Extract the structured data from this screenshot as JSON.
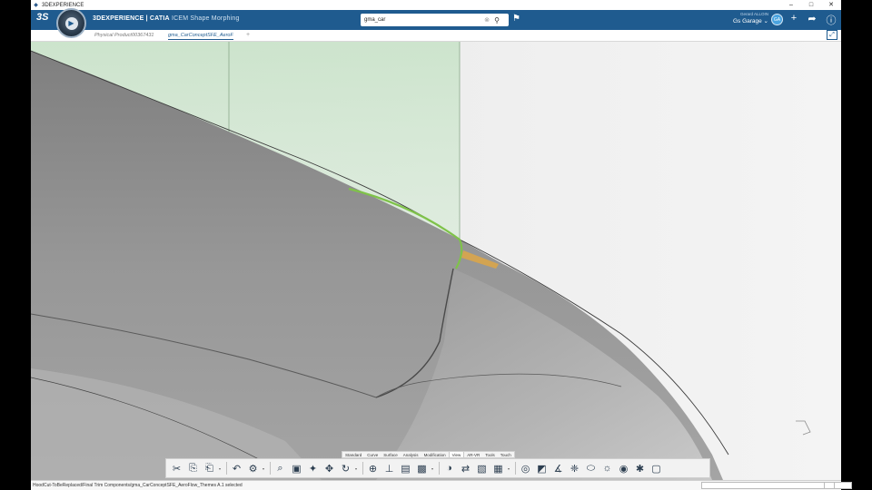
{
  "os_titlebar": {
    "title": "3DEXPERIENCE",
    "buttons": [
      "–",
      "□",
      "✕"
    ]
  },
  "header": {
    "brand_logo": "3S",
    "app_title_bold": "3DEXPERIENCE | CATIA",
    "app_title_light": "ICEM Shape Morphing",
    "search": {
      "value": "gma_car"
    },
    "user_name": "Gerard ALLOIN",
    "user_space": "Gs Garage ⌄",
    "avatar_initials": "GA",
    "icons": {
      "tag": "tag-icon",
      "add": "plus-icon",
      "share": "share-icon",
      "communicate": "communicate-icon",
      "help": "help-icon"
    }
  },
  "tabs": {
    "items": [
      "Physical Product00367431",
      "gma_CarConceptSFE_AeroF"
    ],
    "add_label": "+",
    "expand_label": "⤢"
  },
  "section_tabs": [
    "Standard",
    "Curve",
    "Surface",
    "Analysis",
    "Modification",
    "View",
    "AR-VR",
    "Tools",
    "Touch"
  ],
  "active_section": "View",
  "actionbar_tools": [
    "cut-icon",
    "copy-icon",
    "paste-icon",
    "undo-icon",
    "settings-icon",
    "zoom-icon",
    "view-cube-icon",
    "fit-all-icon",
    "pan-icon",
    "rotate-icon",
    "zoom-in-out-icon",
    "normal-view-icon",
    "quick-view-icon",
    "render-style-icon",
    "hide-show-icon",
    "swap-icon",
    "capture-icon",
    "layout-icon",
    "analysis-icon",
    "sectioning-icon",
    "measure-icon",
    "spread-icon",
    "ground-icon",
    "lighting-icon",
    "environment-icon",
    "compass-icon",
    "ar-icon"
  ],
  "status": {
    "text": "HoodCut-ToBeReplaced/Final Trim Components/gma_CarConceptSFE_AeroFlow_Themes A.1 selected"
  },
  "colors": {
    "header_blue": "#1f5b8f",
    "body_grey": "#8d8d8d",
    "plane_green": "#cfe6cf",
    "selection_green": "#7fc24a",
    "selection_orange": "#d9a54a"
  }
}
